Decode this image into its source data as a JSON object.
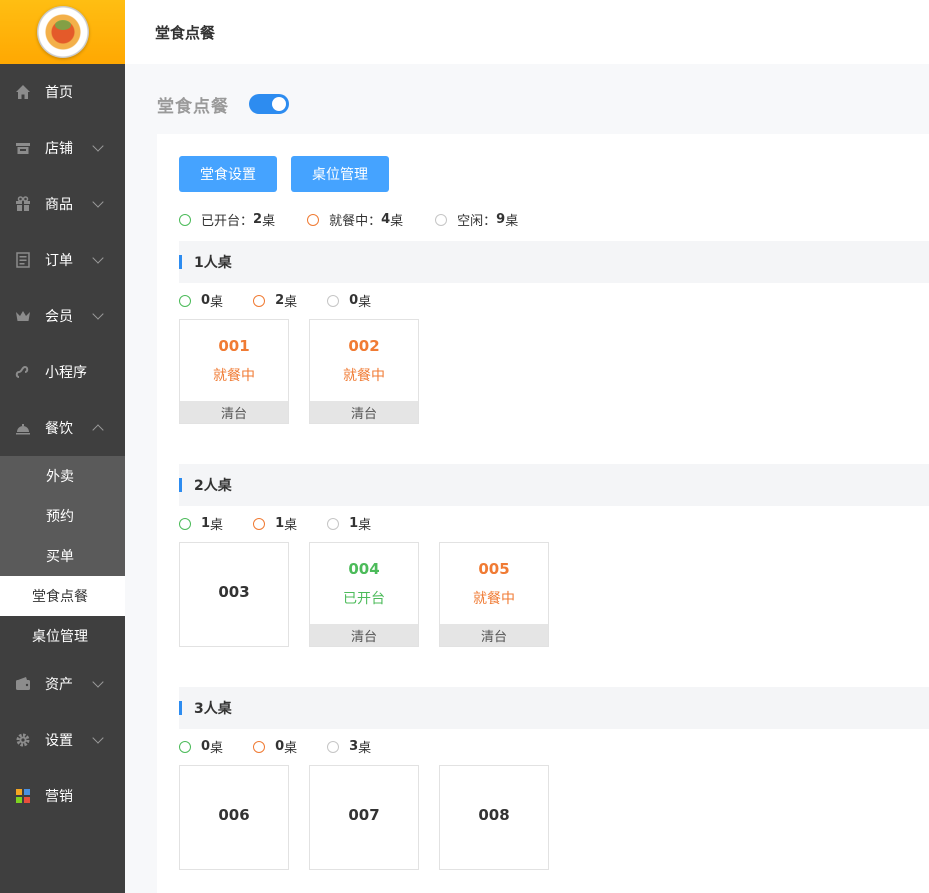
{
  "sidebar": {
    "nav": [
      {
        "label": "首页",
        "icon": "home-icon"
      },
      {
        "label": "店铺",
        "icon": "store-icon"
      },
      {
        "label": "商品",
        "icon": "gift-icon"
      },
      {
        "label": "订单",
        "icon": "order-list-icon"
      },
      {
        "label": "会员",
        "icon": "crown-icon"
      },
      {
        "label": "小程序",
        "icon": "mini-program-icon"
      },
      {
        "label": "餐饮",
        "icon": "dish-cover-icon"
      }
    ],
    "sub": [
      "外卖",
      "预约",
      "买单",
      "堂食点餐",
      "桌位管理"
    ],
    "nav_bottom": [
      {
        "label": "资产",
        "icon": "wallet-icon"
      },
      {
        "label": "设置",
        "icon": "gear-icon"
      },
      {
        "label": "营销",
        "icon": "marketing-grid-icon"
      }
    ]
  },
  "topbar": {
    "title": "堂食点餐"
  },
  "main": {
    "heading": "堂食点餐",
    "toggle_on": true,
    "buttons": {
      "settings": "堂食设置",
      "tables": "桌位管理"
    },
    "summary": {
      "open_label": "已开台：",
      "open_count": "2",
      "busy_label": "就餐中：",
      "busy_count": "4",
      "idle_label": "空闲：",
      "idle_count": "9",
      "unit": "桌"
    },
    "sections": [
      {
        "title": "1人桌",
        "counts": {
          "open": "0",
          "busy": "2",
          "idle": "0"
        },
        "tables": [
          {
            "no": "001",
            "status": "就餐中",
            "action": "清台"
          },
          {
            "no": "002",
            "status": "就餐中",
            "action": "清台"
          }
        ]
      },
      {
        "title": "2人桌",
        "counts": {
          "open": "1",
          "busy": "1",
          "idle": "1"
        },
        "tables": [
          {
            "no": "003"
          },
          {
            "no": "004",
            "status": "已开台",
            "action": "清台"
          },
          {
            "no": "005",
            "status": "就餐中",
            "action": "清台"
          }
        ]
      },
      {
        "title": "3人桌",
        "counts": {
          "open": "0",
          "busy": "0",
          "idle": "3"
        },
        "tables": [
          {
            "no": "006"
          },
          {
            "no": "007"
          },
          {
            "no": "008"
          }
        ]
      }
    ]
  },
  "colors": {
    "accent": "#45a3ff",
    "open": "#4cbb5a",
    "busy": "#f07b34",
    "idle": "#c6c6c6",
    "sidebar": "#3f3f3f",
    "logo": "#ffb30a"
  }
}
